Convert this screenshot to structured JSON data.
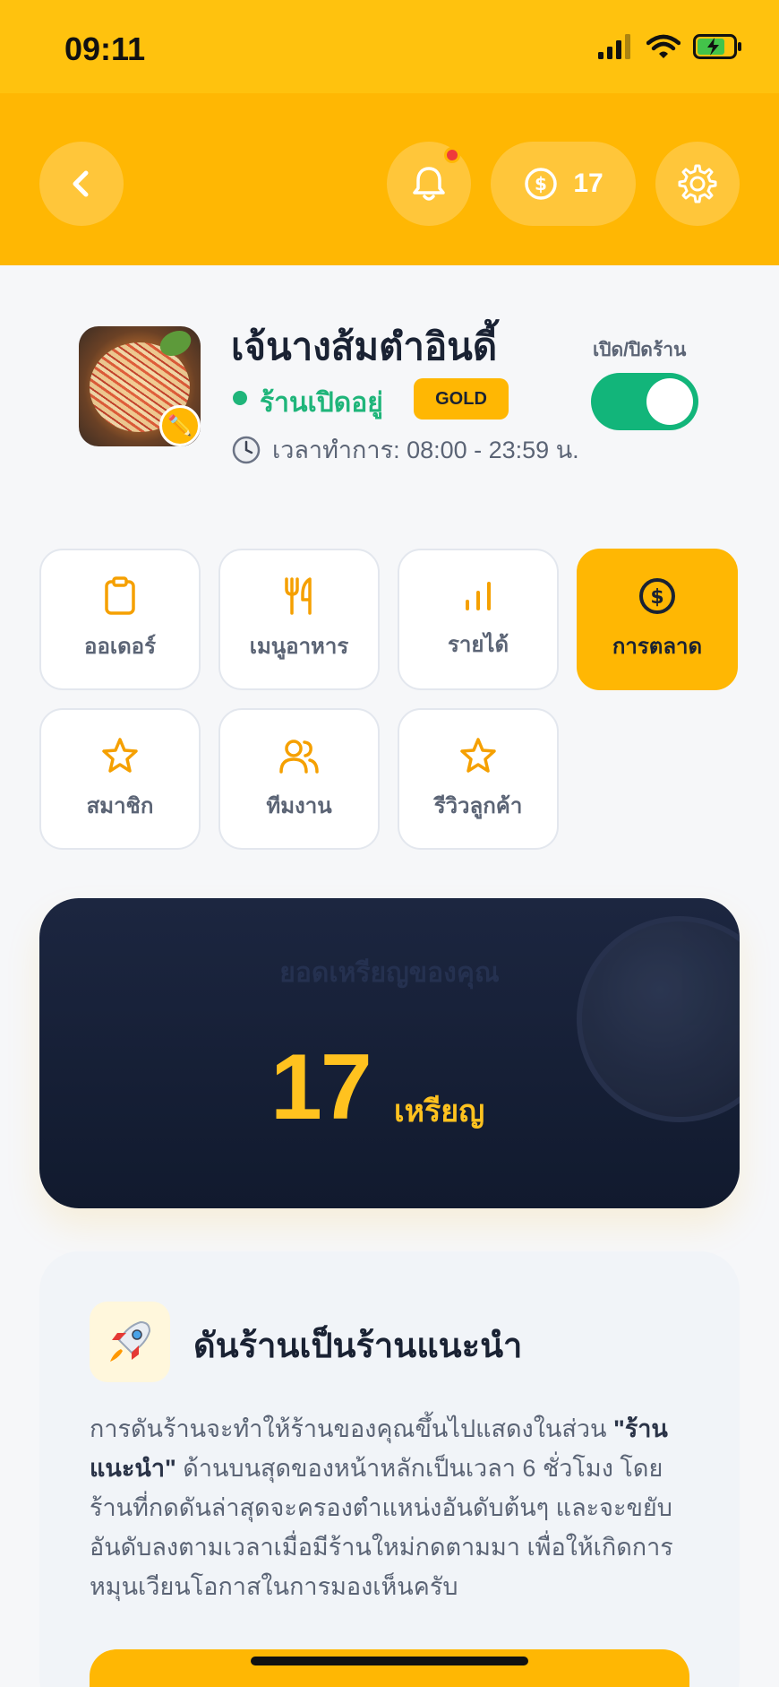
{
  "status_bar": {
    "time": "09:11"
  },
  "header": {
    "coin_count": "17"
  },
  "store": {
    "name": "เจ้นางส้มตำอินดี้",
    "status": "ร้านเปิดอยู่",
    "tier": "GOLD",
    "hours": "เวลาทำการ: 08:00 - 23:59 น.",
    "toggle_label": "เปิด/ปิดร้าน",
    "is_open": true
  },
  "menu_tiles": [
    {
      "label": "ออเดอร์",
      "icon": "clipboard-icon"
    },
    {
      "label": "เมนูอาหาร",
      "icon": "utensils-icon"
    },
    {
      "label": "รายได้",
      "icon": "bar-chart-icon"
    },
    {
      "label": "การตลาด",
      "icon": "dollar-coin-icon",
      "active": true
    },
    {
      "label": "สมาชิก",
      "icon": "star-icon"
    },
    {
      "label": "ทีมงาน",
      "icon": "users-icon"
    },
    {
      "label": "รีวิวลูกค้า",
      "icon": "star-icon"
    }
  ],
  "balance": {
    "label": "ยอดเหรียญของคุณ",
    "value": "17",
    "unit": "เหรียญ"
  },
  "promo": {
    "title": "ดันร้านเป็นร้านแนะนำ",
    "text_before": "การดันร้านจะทำให้ร้านของคุณขึ้นไปแสดงในส่วน ",
    "text_bold": "\"ร้านแนะนำ\"",
    "text_after": " ด้านบนสุดของหน้าหลักเป็นเวลา 6 ชั่วโมง โดยร้านที่กดดันล่าสุดจะครองตำแหน่งอันดับต้นๆ และจะขยับอันดับลงตามเวลาเมื่อมีร้านใหม่กดตามมา เพื่อให้เกิดการหมุนเวียนโอกาสในการมองเห็นครับ"
  },
  "colors": {
    "accent": "#ffb703",
    "status_bar": "#ffc20e",
    "open_green": "#1fb57a",
    "card_dark": "#1c2640",
    "coin_gold": "#ffc21f"
  }
}
